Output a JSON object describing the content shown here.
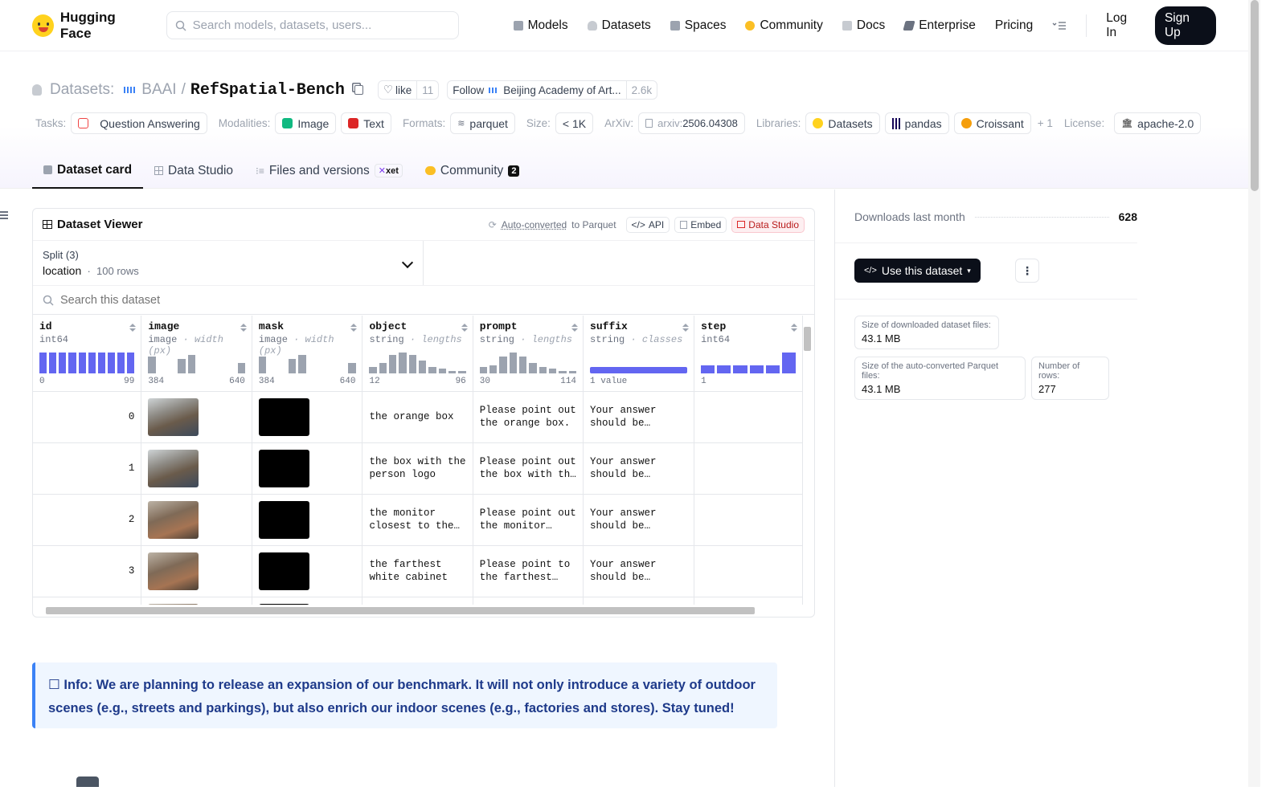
{
  "nav": {
    "brand": "Hugging Face",
    "search_placeholder": "Search models, datasets, users...",
    "items": [
      {
        "label": "Models",
        "icon": "cube-icon",
        "color": "#9ca3af"
      },
      {
        "label": "Datasets",
        "icon": "database-icon",
        "color": "#c7cbd1"
      },
      {
        "label": "Spaces",
        "icon": "grid-icon",
        "color": "#9ca3af"
      },
      {
        "label": "Community",
        "icon": "chat-icon",
        "color": "#fbbf24"
      },
      {
        "label": "Docs",
        "icon": "book-icon",
        "color": "#9ca3af"
      },
      {
        "label": "Enterprise",
        "icon": "briefcase-icon",
        "color": "#6b7280"
      },
      {
        "label": "Pricing",
        "icon": "",
        "color": ""
      }
    ],
    "login": "Log In",
    "signup": "Sign Up"
  },
  "header": {
    "section": "Datasets:",
    "org": "BAAI",
    "slash": "/",
    "name": "RefSpatial-Bench",
    "like_label": "like",
    "like_count": "11",
    "follow_label": "Follow",
    "follow_org": "Beijing Academy of Art...",
    "follow_count": "2.6k"
  },
  "tags": {
    "tasks_label": "Tasks:",
    "tasks": [
      "Question Answering"
    ],
    "modalities_label": "Modalities:",
    "modalities": [
      "Image",
      "Text"
    ],
    "formats_label": "Formats:",
    "formats": [
      "parquet"
    ],
    "size_label": "Size:",
    "size": "< 1K",
    "arxiv_label": "ArXiv:",
    "arxiv_prefix": "arxiv:",
    "arxiv_id": "2506.04308",
    "libraries_label": "Libraries:",
    "libraries": [
      "Datasets",
      "pandas",
      "Croissant"
    ],
    "libraries_more": "+ 1",
    "license_label": "License:",
    "license": "apache-2.0"
  },
  "tabs": [
    {
      "label": "Dataset card",
      "active": true
    },
    {
      "label": "Data Studio",
      "active": false
    },
    {
      "label": "Files and versions",
      "active": false,
      "badge": "xet"
    },
    {
      "label": "Community",
      "active": false,
      "badge": "2"
    }
  ],
  "viewer": {
    "title": "Dataset Viewer",
    "auto_converted": "Auto-converted",
    "to_parquet": "to Parquet",
    "api": "API",
    "embed": "Embed",
    "data_studio": "Data Studio",
    "split_label": "Split (3)",
    "split_value": "location",
    "split_rows": "100 rows",
    "search_placeholder": "Search this dataset",
    "columns": [
      {
        "name": "id",
        "type": "int64",
        "sub": "",
        "min": "0",
        "max": "99",
        "hist": [
          1,
          1,
          1,
          1,
          1,
          1,
          1,
          1,
          1,
          1
        ],
        "hist_style": "blue"
      },
      {
        "name": "image",
        "type": "image",
        "sub": "width (px)",
        "min": "384",
        "max": "640",
        "hist": [
          0.8,
          0,
          0,
          0.7,
          0.9,
          0,
          0,
          0,
          0,
          0.5
        ],
        "hist_style": "gray"
      },
      {
        "name": "mask",
        "type": "image",
        "sub": "width (px)",
        "min": "384",
        "max": "640",
        "hist": [
          0.8,
          0,
          0,
          0.7,
          0.9,
          0,
          0,
          0,
          0,
          0.5
        ],
        "hist_style": "gray"
      },
      {
        "name": "object",
        "type": "string",
        "sub": "lengths",
        "min": "12",
        "max": "96",
        "hist": [
          0.3,
          0.5,
          0.9,
          1,
          0.9,
          0.6,
          0.3,
          0.25,
          0.05,
          0.05
        ],
        "hist_style": "gray"
      },
      {
        "name": "prompt",
        "type": "string",
        "sub": "lengths",
        "min": "30",
        "max": "114",
        "hist": [
          0.3,
          0.4,
          0.8,
          1,
          0.8,
          0.5,
          0.3,
          0.25,
          0.05,
          0.05
        ],
        "hist_style": "gray"
      },
      {
        "name": "suffix",
        "type": "string",
        "sub": "classes",
        "min": "1 value",
        "max": "",
        "hist": [],
        "hist_style": "full"
      },
      {
        "name": "step",
        "type": "int64",
        "sub": "",
        "min": "1",
        "max": "",
        "hist": [
          0.4,
          0.4,
          0.4,
          0.4,
          0.4,
          1
        ],
        "hist_style": "blue"
      }
    ],
    "rows": [
      {
        "id": "0",
        "object": "the orange box",
        "prompt": "Please point out the orange box.",
        "suffix": "Your answer should be formatted as a list of tuples"
      },
      {
        "id": "1",
        "object": "the box with the person logo",
        "prompt": "Please point out the box with the person logo.",
        "suffix": "Your answer should be formatted as a list of tuples"
      },
      {
        "id": "2",
        "object": "the monitor closest to the window",
        "prompt": "Please point out the monitor closest to the window.",
        "suffix": "Your answer should be formatted as a list of tuples"
      },
      {
        "id": "3",
        "object": "the farthest white cabinet",
        "prompt": "Please point to the farthest white cabinet.",
        "suffix": "Your answer should be formatted as a list of tuples"
      }
    ]
  },
  "sidebar": {
    "downloads_label": "Downloads last month",
    "downloads_value": "628",
    "use_dataset": "Use this dataset",
    "stats": [
      {
        "label": "Size of downloaded dataset files:",
        "value": "43.1 MB"
      },
      {
        "label": "Size of the auto-converted Parquet files:",
        "value": "43.1 MB"
      },
      {
        "label": "Number of rows:",
        "value": "277"
      }
    ]
  },
  "info": {
    "icon": "☐",
    "text": "Info: We are planning to release an expansion of our benchmark. It will not only introduce a variety of outdoor scenes (e.g., streets and parkings), but also enrich our indoor scenes (e.g., factories and stores). Stay tuned!"
  }
}
